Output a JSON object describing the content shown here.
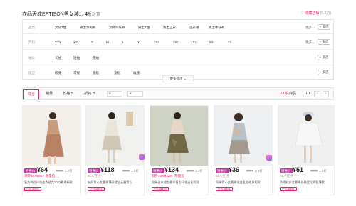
{
  "shop": {
    "name": "衣品天成EPTISON男女装...",
    "discount_value": "4",
    "discount_suffix": "折封顶",
    "fav_label": "♡ 收藏店铺",
    "fav_count": "(5.3万)"
  },
  "filters": [
    {
      "label": "品类",
      "options": [
        "女装T恤",
        "男士休闲裤",
        "女式牛仔裤",
        "男士T恤",
        "男士卫衣",
        "连衣裙",
        "男士牛仔裤"
      ],
      "more": "更多 ⌄",
      "multi": "+ 多选"
    },
    {
      "label": "尺码",
      "options": [
        "XXS",
        "XS",
        "S",
        "M",
        "L",
        "XL",
        "2XL",
        "3XL",
        "4XL",
        "5XL",
        "2S"
      ],
      "more": "更多 ⌄",
      "multi": "+ 多选"
    },
    {
      "label": "袖长",
      "options": [
        "长袖",
        "短袖",
        "无袖"
      ],
      "multi": "+ 多选"
    },
    {
      "label": "版型",
      "options": [
        "修身",
        "常规",
        "宽松",
        "宽松",
        "收腰"
      ],
      "multi": "+ 多选"
    }
  ],
  "more_options": "更多选项 ⌄",
  "sort": {
    "items": [
      "综合",
      "销量",
      "价格 ⇅",
      "折扣 ⇅"
    ],
    "active": 0,
    "price_min_placeholder": "¥",
    "price_max_placeholder": "¥",
    "dash": "-",
    "total_count": "200件",
    "total_unit": "商品",
    "page": "1/1",
    "prev": "‹",
    "next": "›"
  },
  "products": [
    {
      "badge": "特惠价",
      "price": "¥64",
      "orig": "¥129",
      "disc": "1.2折",
      "sub": "领券10.8¥62、限量抢",
      "title": "复古碎花印花连衣裙女2023夏季新款",
      "tag": "已优惠¥65",
      "sub_gray": false
    },
    {
      "badge": "特惠价",
      "price": "¥118",
      "orig": "¥229",
      "disc": "1.2折",
      "sub": "81人在拼",
      "title": "针织背心女夏季薄款镂空无袖背心",
      "tag": "已优惠¥81",
      "sub_gray": true
    },
    {
      "badge": "特惠价",
      "price": "¥134",
      "orig": "¥229",
      "disc": "1.3折",
      "sub": "领券10.8¥125、限量抢",
      "title": "吊带连衣裙女夏季复古印花迷彩短裙",
      "tag": "已优惠¥95",
      "sub_gray": false
    },
    {
      "badge": "特惠价",
      "price": "¥36",
      "orig": "¥139",
      "disc": "0.8折",
      "sub": "81人在拼",
      "title": "吊带背心女夏季渐变扎染修身短款",
      "tag": "已优惠¥81",
      "sub_gray": true
    },
    {
      "badge": "特惠价",
      "price": "¥51",
      "orig": "¥169",
      "disc": "1.2折",
      "sub": "81人在拼",
      "title": "防晒衬衫女夏季长袖宽松外套薄款",
      "tag": "已优惠¥81",
      "sub_gray": true
    }
  ],
  "colors": {
    "accent": "#e6246f",
    "badge": "#c535a6"
  }
}
